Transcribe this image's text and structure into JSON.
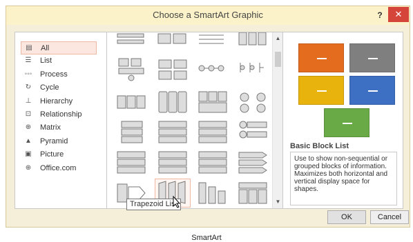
{
  "dialog": {
    "title": "Choose a SmartArt Graphic",
    "help_label": "?",
    "close_label": "✕"
  },
  "categories": [
    {
      "label": "All",
      "icon": "all-icon",
      "selected": true
    },
    {
      "label": "List",
      "icon": "list-icon"
    },
    {
      "label": "Process",
      "icon": "process-icon"
    },
    {
      "label": "Cycle",
      "icon": "cycle-icon"
    },
    {
      "label": "Hierarchy",
      "icon": "hierarchy-icon"
    },
    {
      "label": "Relationship",
      "icon": "relationship-icon"
    },
    {
      "label": "Matrix",
      "icon": "matrix-icon"
    },
    {
      "label": "Pyramid",
      "icon": "pyramid-icon"
    },
    {
      "label": "Picture",
      "icon": "picture-icon"
    },
    {
      "label": "Office.com",
      "icon": "globe-icon"
    }
  ],
  "gallery": {
    "hovered_item": "Trapezoid List",
    "scroll_up": "^",
    "scroll_down": "v"
  },
  "preview": {
    "colors": [
      "#e36c1e",
      "#7f7f7f",
      "#e8b30c",
      "#3d6fc2",
      "#6aaa46"
    ],
    "title": "Basic Block List",
    "description": "Use to show non-sequential or grouped blocks of information. Maximizes both horizontal and vertical display space for shapes."
  },
  "buttons": {
    "ok": "OK",
    "cancel": "Cancel"
  },
  "tooltip": "Trapezoid List",
  "caption": "SmartArt"
}
